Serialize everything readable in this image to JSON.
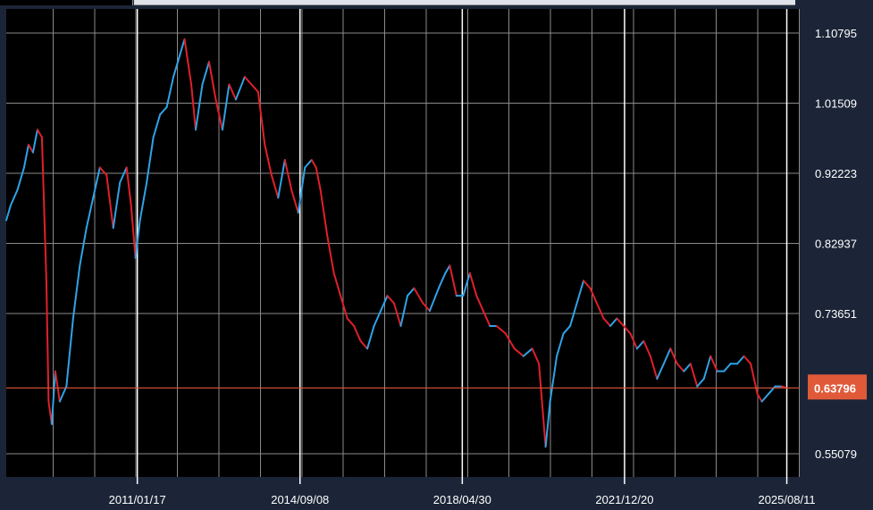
{
  "chart_data": {
    "type": "line",
    "title": "",
    "xlabel": "",
    "ylabel": "",
    "y_ticks": [
      "1.10795",
      "1.01509",
      "0.92223",
      "0.82937",
      "0.73651",
      "0.55079"
    ],
    "x_ticks": [
      "2011/01/17",
      "2014/09/08",
      "2018/04/30",
      "2021/12/20",
      "2025/08/11"
    ],
    "current_value": "0.63796",
    "ylim": [
      0.52,
      1.14
    ],
    "xlim": [
      2008.1,
      2025.9
    ],
    "grid": true,
    "colors": {
      "up": "#2fa3e6",
      "down": "#e0202a",
      "current_line": "#e0563a",
      "current_label_bg": "#e05a3a",
      "grid": "#8a8a8a"
    },
    "series": [
      {
        "values": [
          [
            2008.1,
            0.86
          ],
          [
            2008.2,
            0.88
          ],
          [
            2008.35,
            0.9
          ],
          [
            2008.5,
            0.93
          ],
          [
            2008.6,
            0.96
          ],
          [
            2008.7,
            0.95
          ],
          [
            2008.8,
            0.98
          ],
          [
            2008.9,
            0.97
          ],
          [
            2009.0,
            0.78
          ],
          [
            2009.05,
            0.62
          ],
          [
            2009.12,
            0.59
          ],
          [
            2009.2,
            0.66
          ],
          [
            2009.3,
            0.62
          ],
          [
            2009.45,
            0.64
          ],
          [
            2009.6,
            0.73
          ],
          [
            2009.75,
            0.8
          ],
          [
            2009.9,
            0.85
          ],
          [
            2010.05,
            0.89
          ],
          [
            2010.2,
            0.93
          ],
          [
            2010.35,
            0.92
          ],
          [
            2010.5,
            0.85
          ],
          [
            2010.65,
            0.91
          ],
          [
            2010.8,
            0.93
          ],
          [
            2010.9,
            0.88
          ],
          [
            2011.0,
            0.81
          ],
          [
            2011.1,
            0.86
          ],
          [
            2011.25,
            0.91
          ],
          [
            2011.4,
            0.97
          ],
          [
            2011.55,
            1.0
          ],
          [
            2011.7,
            1.01
          ],
          [
            2011.85,
            1.05
          ],
          [
            2012.0,
            1.08
          ],
          [
            2012.1,
            1.1
          ],
          [
            2012.25,
            1.04
          ],
          [
            2012.35,
            0.98
          ],
          [
            2012.5,
            1.04
          ],
          [
            2012.65,
            1.07
          ],
          [
            2012.8,
            1.02
          ],
          [
            2012.95,
            0.98
          ],
          [
            2013.1,
            1.04
          ],
          [
            2013.25,
            1.02
          ],
          [
            2013.45,
            1.05
          ],
          [
            2013.6,
            1.04
          ],
          [
            2013.75,
            1.03
          ],
          [
            2013.9,
            0.96
          ],
          [
            2014.05,
            0.92
          ],
          [
            2014.2,
            0.89
          ],
          [
            2014.35,
            0.94
          ],
          [
            2014.5,
            0.9
          ],
          [
            2014.65,
            0.87
          ],
          [
            2014.8,
            0.93
          ],
          [
            2014.95,
            0.94
          ],
          [
            2015.05,
            0.93
          ],
          [
            2015.15,
            0.9
          ],
          [
            2015.3,
            0.84
          ],
          [
            2015.45,
            0.79
          ],
          [
            2015.6,
            0.76
          ],
          [
            2015.75,
            0.73
          ],
          [
            2015.9,
            0.72
          ],
          [
            2016.05,
            0.7
          ],
          [
            2016.2,
            0.69
          ],
          [
            2016.35,
            0.72
          ],
          [
            2016.5,
            0.74
          ],
          [
            2016.65,
            0.76
          ],
          [
            2016.8,
            0.75
          ],
          [
            2016.95,
            0.72
          ],
          [
            2017.1,
            0.76
          ],
          [
            2017.25,
            0.77
          ],
          [
            2017.45,
            0.75
          ],
          [
            2017.6,
            0.74
          ],
          [
            2017.8,
            0.77
          ],
          [
            2017.95,
            0.79
          ],
          [
            2018.05,
            0.8
          ],
          [
            2018.2,
            0.76
          ],
          [
            2018.35,
            0.76
          ],
          [
            2018.5,
            0.79
          ],
          [
            2018.65,
            0.76
          ],
          [
            2018.8,
            0.74
          ],
          [
            2018.95,
            0.72
          ],
          [
            2019.1,
            0.72
          ],
          [
            2019.3,
            0.71
          ],
          [
            2019.5,
            0.69
          ],
          [
            2019.7,
            0.68
          ],
          [
            2019.9,
            0.69
          ],
          [
            2020.05,
            0.67
          ],
          [
            2020.2,
            0.56
          ],
          [
            2020.3,
            0.62
          ],
          [
            2020.45,
            0.68
          ],
          [
            2020.6,
            0.71
          ],
          [
            2020.75,
            0.72
          ],
          [
            2020.9,
            0.75
          ],
          [
            2021.05,
            0.78
          ],
          [
            2021.2,
            0.77
          ],
          [
            2021.35,
            0.75
          ],
          [
            2021.5,
            0.73
          ],
          [
            2021.65,
            0.72
          ],
          [
            2021.8,
            0.73
          ],
          [
            2021.95,
            0.72
          ],
          [
            2022.1,
            0.71
          ],
          [
            2022.25,
            0.69
          ],
          [
            2022.4,
            0.7
          ],
          [
            2022.55,
            0.68
          ],
          [
            2022.7,
            0.65
          ],
          [
            2022.85,
            0.67
          ],
          [
            2023.0,
            0.69
          ],
          [
            2023.15,
            0.67
          ],
          [
            2023.3,
            0.66
          ],
          [
            2023.45,
            0.67
          ],
          [
            2023.6,
            0.64
          ],
          [
            2023.75,
            0.65
          ],
          [
            2023.9,
            0.68
          ],
          [
            2024.05,
            0.66
          ],
          [
            2024.2,
            0.66
          ],
          [
            2024.35,
            0.67
          ],
          [
            2024.5,
            0.67
          ],
          [
            2024.65,
            0.68
          ],
          [
            2024.8,
            0.67
          ],
          [
            2024.95,
            0.63
          ],
          [
            2025.05,
            0.62
          ],
          [
            2025.2,
            0.63
          ],
          [
            2025.35,
            0.64
          ],
          [
            2025.5,
            0.64
          ],
          [
            2025.6,
            0.63796
          ]
        ]
      }
    ]
  }
}
